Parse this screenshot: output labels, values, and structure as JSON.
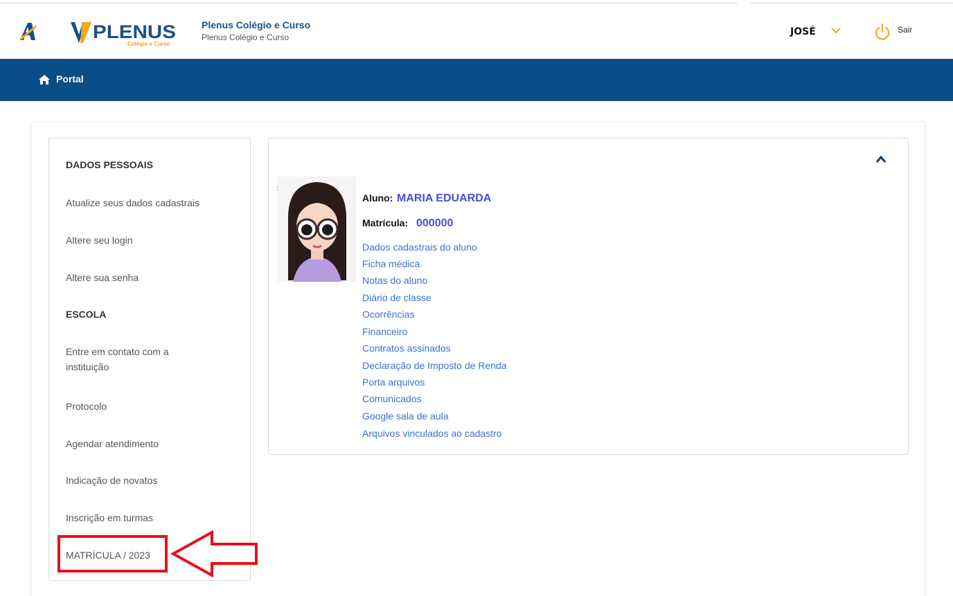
{
  "header": {
    "brand_title": "Plenus Colégio e Curso",
    "brand_subtitle": "Plenus Colégio e Curso",
    "logo_text": "PLENUS",
    "logo_subtext": "Colégio e Curso",
    "user_name": "JOSÉ",
    "logout_label": "Sair"
  },
  "nav": {
    "portal_label": "Portal"
  },
  "sidebar": {
    "section_personal": "DADOS PESSOAIS",
    "personal_items": [
      "Atualize seus dados cadastrais",
      "Altere seu login",
      "Altere sua senha"
    ],
    "section_school": "ESCOLA",
    "contact_line1": "Entre em contato com a",
    "contact_line2": "instituição",
    "school_items": [
      "Protocolo",
      "Agendar atendimento",
      "Indicação de novatos",
      "Inscrição em turmas",
      "MATRÍCULA / 2023"
    ]
  },
  "student": {
    "student_label": "Aluno:",
    "student_name": "MARIA EDUARDA",
    "enrollment_label": "Matrícula:",
    "enrollment_number": "000000",
    "links": [
      "Dados cadastrais do aluno",
      "Ficha médica",
      "Notas do aluno",
      "Diário de classe",
      "Ocorrências",
      "Financeiro",
      "Contratos assinados",
      "Declaração de Imposto de Renda",
      "Porta arquivos",
      "Comunicados",
      "Google sala de aula",
      "Arquivos vinculados ao cadastro"
    ]
  },
  "colors": {
    "navbar": "#0a4d87",
    "brand_blue": "#1b4f8c",
    "link_blue": "#3d6fd1",
    "value_blue": "#4a4fcf",
    "accent_orange": "#f5a623",
    "annotation_red": "#e8101a"
  },
  "icons": {
    "app": "app-logo-icon",
    "chevron": "chevron-down-icon",
    "power": "power-icon",
    "home": "home-icon",
    "collapse": "chevron-up-icon"
  }
}
